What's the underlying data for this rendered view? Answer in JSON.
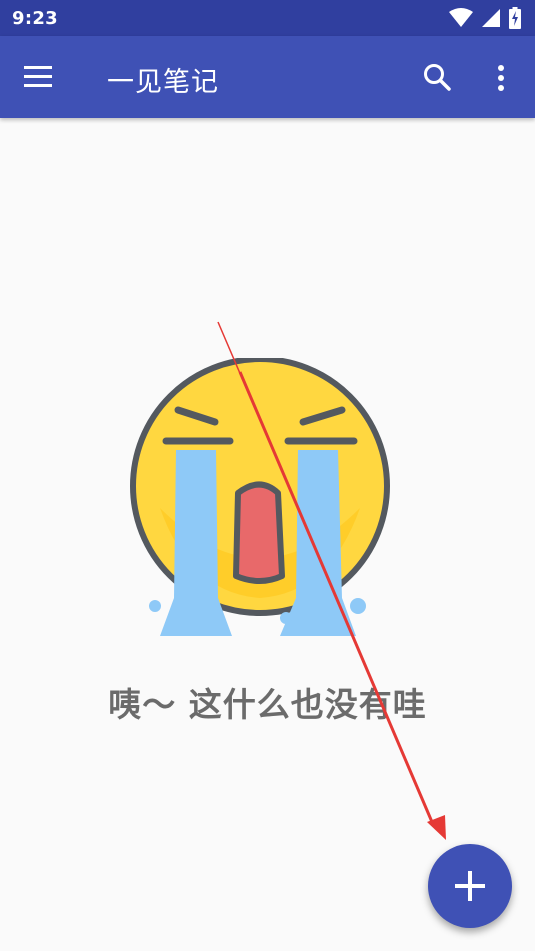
{
  "status_bar": {
    "time": "9:23",
    "icons": [
      "wifi-icon",
      "signal-icon",
      "battery-charging-icon"
    ]
  },
  "app_bar": {
    "title": "一见笔记",
    "menu_icon": "menu-icon",
    "search_icon": "search-icon",
    "more_icon": "more-vert-icon",
    "color": "#3f51b5",
    "status_color": "#303f9f"
  },
  "empty_state": {
    "message": "咦～ 这什么也没有哇",
    "illustration": "crying-face-icon"
  },
  "fab": {
    "icon": "add-icon",
    "color": "#3f51b5"
  },
  "annotation": {
    "arrow_color": "#e53935"
  }
}
